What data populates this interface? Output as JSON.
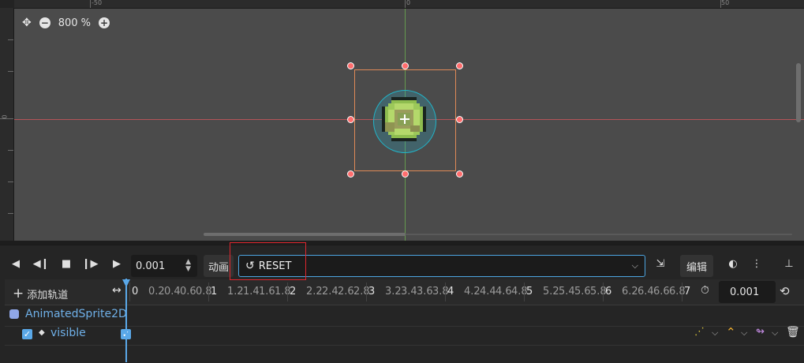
{
  "viewport": {
    "ruler_top_labels": [
      "-50",
      "0",
      "50"
    ],
    "ruler_left_labels": [
      "0"
    ],
    "zoom": "800 %",
    "icons": [
      "transform-icon",
      "zoom-out-icon",
      "zoom-in-icon"
    ]
  },
  "anim_toolbar": {
    "time_value": "0.001",
    "animation_label": "动画",
    "selected_animation": "RESET",
    "edit_label": "编辑"
  },
  "timeline": {
    "add_track_label": "添加轨道",
    "ticks": [
      "0",
      "0.2",
      "0.4",
      "0.6",
      "0.8",
      "1",
      "1.2",
      "1.4",
      "1.6",
      "1.8",
      "2",
      "2.2",
      "2.4",
      "2.6",
      "2.8",
      "3",
      "3.2",
      "3.4",
      "3.6",
      "3.8",
      "4",
      "4.2",
      "4.4",
      "4.6",
      "4.8",
      "5",
      "5.2",
      "5.4",
      "5.6",
      "5.8",
      "6",
      "6.2",
      "6.4",
      "6.6",
      "6.8",
      "7"
    ],
    "length_value": "0.001",
    "node_name": "AnimatedSprite2D",
    "property_name": "visible"
  },
  "colors": {
    "accent": "#5aa8e8",
    "highlight": "#e0262e",
    "selection": "#e08a57"
  }
}
